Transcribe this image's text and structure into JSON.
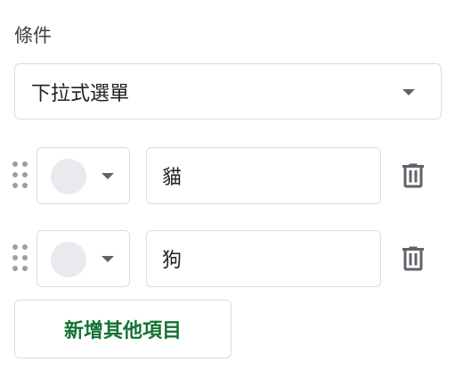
{
  "section": {
    "label": "條件"
  },
  "dropdown": {
    "selected": "下拉式選單"
  },
  "options": [
    {
      "value": "貓",
      "swatch_color": "#e8eaed"
    },
    {
      "value": "狗",
      "swatch_color": "#e8eaed"
    }
  ],
  "icons": {
    "drag": "drag-handle-icon",
    "caret": "chevron-down-icon",
    "delete": "trash-icon"
  },
  "add_button": {
    "label": "新增其他項目"
  },
  "colors": {
    "border": "#dadce0",
    "icon": "#5f6368",
    "accent_green": "#137333",
    "swatch": "#e8eaed"
  }
}
